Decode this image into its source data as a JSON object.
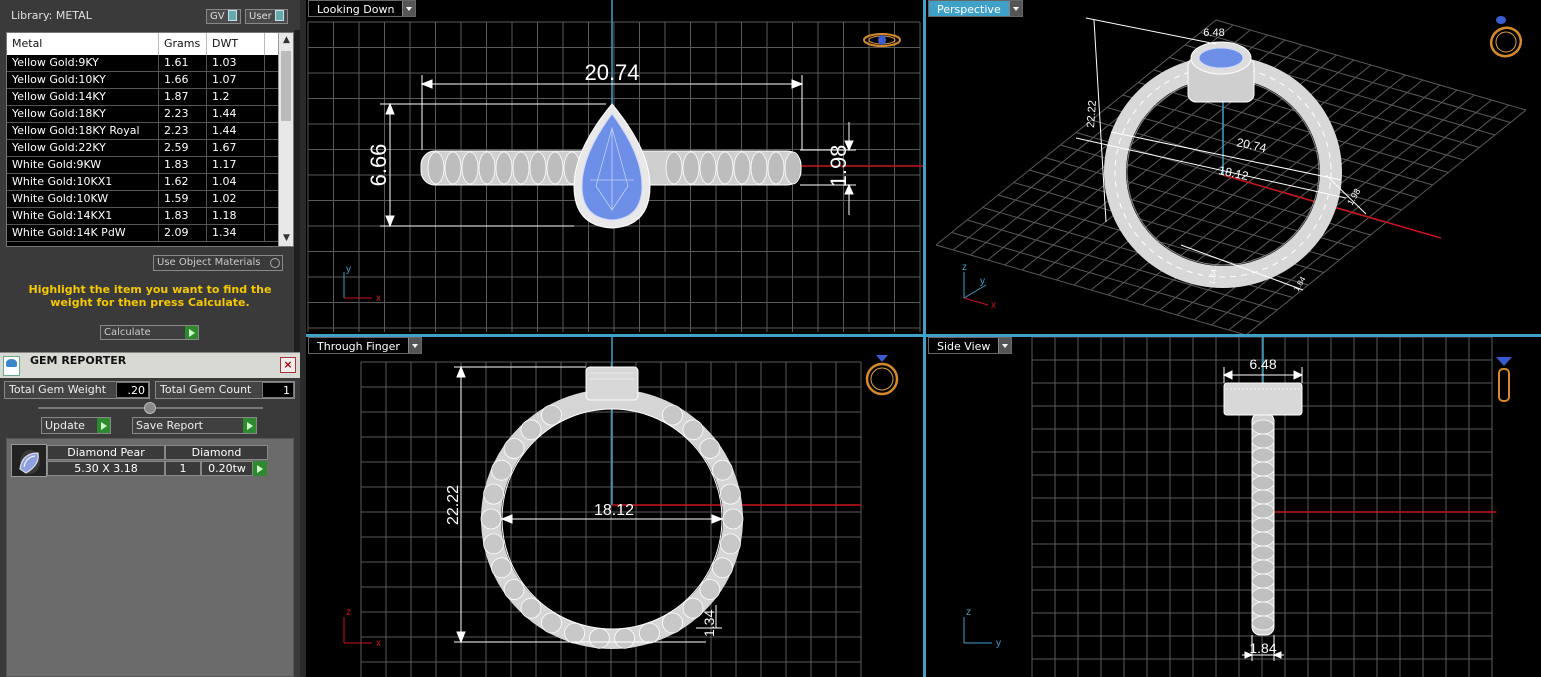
{
  "library": {
    "title": "Library: METAL",
    "gv_label": "GV",
    "user_label": "User",
    "columns": [
      "Metal",
      "Grams",
      "DWT"
    ],
    "rows": [
      [
        "Yellow Gold:9KY",
        "1.61",
        "1.03"
      ],
      [
        "Yellow Gold:10KY",
        "1.66",
        "1.07"
      ],
      [
        "Yellow Gold:14KY",
        "1.87",
        "1.2"
      ],
      [
        "Yellow Gold:18KY",
        "2.23",
        "1.44"
      ],
      [
        "Yellow Gold:18KY Royal",
        "2.23",
        "1.44"
      ],
      [
        "Yellow Gold:22KY",
        "2.59",
        "1.67"
      ],
      [
        "White Gold:9KW",
        "1.83",
        "1.17"
      ],
      [
        "White Gold:10KX1",
        "1.62",
        "1.04"
      ],
      [
        "White Gold:10KW",
        "1.59",
        "1.02"
      ],
      [
        "White Gold:14KX1",
        "1.83",
        "1.18"
      ],
      [
        "White Gold:14K PdW",
        "2.09",
        "1.34"
      ]
    ],
    "use_object_materials": "Use Object Materials",
    "instruction": "Highlight the item you want to find the weight for then press Calculate.",
    "calculate_label": "Calculate"
  },
  "gem_reporter": {
    "title": "GEM REPORTER",
    "close": "×",
    "total_weight_label": "Total Gem Weight",
    "total_weight_value": ".20",
    "total_count_label": "Total Gem Count",
    "total_count_value": "1",
    "update_label": "Update",
    "save_report_label": "Save Report",
    "gem": {
      "name": "Diamond Pear",
      "size": "5.30 X 3.18",
      "material": "Diamond",
      "count": "1",
      "weight": "0.20tw"
    }
  },
  "viewports": {
    "looking_down": {
      "label": "Looking Down",
      "dims": {
        "length": "20.74",
        "height": "6.66",
        "band": "1.98"
      },
      "axes": {
        "v": "y",
        "h": "x"
      }
    },
    "perspective": {
      "label": "Perspective",
      "dims": {
        "top": "6.48",
        "diam": "18.12",
        "outer": "20.74",
        "height": "22.22",
        "side": "1.98",
        "a": "1.34",
        "b": "1.84"
      },
      "axes": {
        "z": "z",
        "y": "y",
        "x": "x"
      }
    },
    "through_finger": {
      "label": "Through Finger",
      "dims": {
        "height": "22.22",
        "diam": "18.12",
        "thickness": "1.34"
      },
      "axes": {
        "v": "z",
        "h": "x"
      }
    },
    "side_view": {
      "label": "Side View",
      "dims": {
        "top": "6.48",
        "bottom": "1.84"
      },
      "axes": {
        "v": "z",
        "h": "y"
      }
    }
  },
  "colors": {
    "grid": "#5a5a5a",
    "accent_blue": "#3fa0c8",
    "axis_red": "#c8141e",
    "gem": "#6d8fe8",
    "instruction": "#f5c800"
  }
}
